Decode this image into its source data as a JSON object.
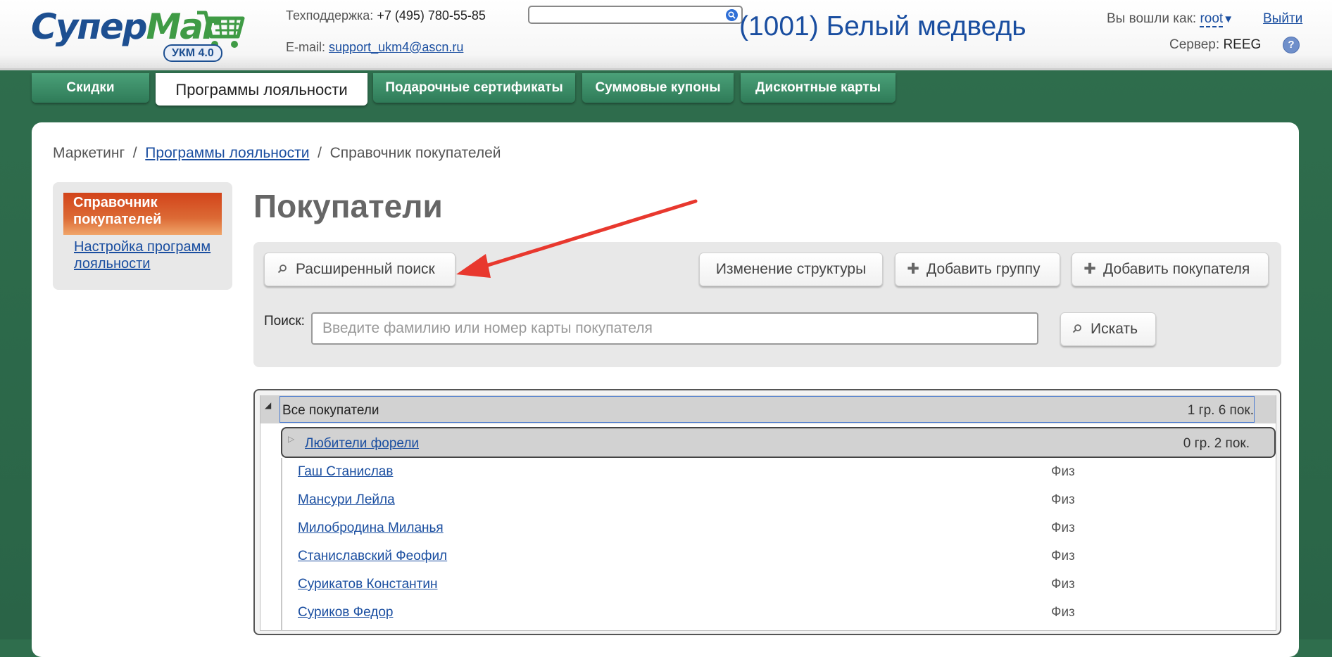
{
  "header": {
    "logo": {
      "word_blue": "Супер",
      "word_green": "Маг",
      "badge": "УКМ 4.0"
    },
    "support_label": "Техподдержка:",
    "support_phone": "+7 (495) 780-55-85",
    "email_label": "E-mail:",
    "email": "support_ukm4@ascn.ru",
    "search_value": "",
    "store_title": "(1001) Белый медведь",
    "logged_in_label": "Вы вошли как:",
    "user": "root",
    "logout": "Выйти",
    "server_label": "Сервер:",
    "server": "REEG",
    "help": "?"
  },
  "tabs": [
    {
      "label": "Скидки",
      "active": false
    },
    {
      "label": "Программы лояльности",
      "active": true
    },
    {
      "label": "Подарочные сертификаты",
      "active": false
    },
    {
      "label": "Суммовые купоны",
      "active": false
    },
    {
      "label": "Дисконтные карты",
      "active": false
    }
  ],
  "breadcrumb": {
    "root": "Маркетинг",
    "sep": "/",
    "link": "Программы лояльности",
    "current": "Справочник покупателей"
  },
  "sidebar": {
    "active_item": "Справочник покупателей",
    "link_item": "Настройка программ лояльности"
  },
  "page_title": "Покупатели",
  "toolbar": {
    "advanced_search": "Расширенный поиск",
    "change_structure": "Изменение структуры",
    "add_group": "Добавить группу",
    "add_customer": "Добавить покупателя",
    "search_label": "Поиск:",
    "search_placeholder": "Введите фамилию или номер карты покупателя",
    "search_button": "Искать"
  },
  "tree": {
    "root_label": "Все покупатели",
    "root_count": "1 гр. 6 пок.",
    "group_label": "Любители форели",
    "group_count": "0 гр. 2 пок.",
    "customers": [
      {
        "name": "Гаш Станислав",
        "type": "Физ"
      },
      {
        "name": "Мансури Лейла",
        "type": "Физ"
      },
      {
        "name": "Милобродина Миланья",
        "type": "Физ"
      },
      {
        "name": "Станиславский Феофил",
        "type": "Физ"
      },
      {
        "name": "Сурикатов Константин",
        "type": "Физ"
      },
      {
        "name": "Суриков Федор",
        "type": "Физ"
      }
    ]
  },
  "colors": {
    "background_green": "#2f6e4d",
    "tab_green": "#3a8c65",
    "link_blue": "#1a4ea0",
    "side_active": "#d2431a",
    "annotation_arrow": "#e8382e"
  }
}
